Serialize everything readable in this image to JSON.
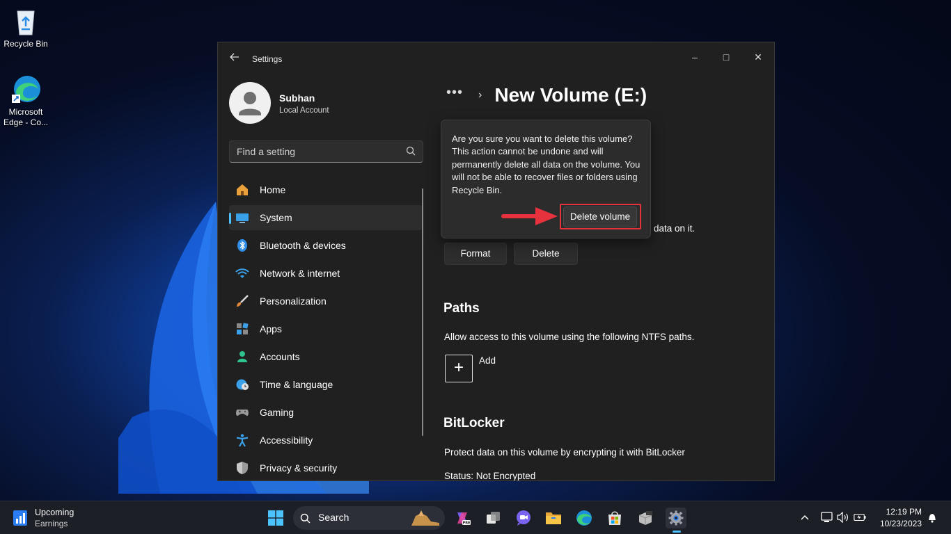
{
  "desktop": {
    "icons": [
      {
        "label": "Recycle Bin"
      },
      {
        "label": "Microsoft Edge - Co..."
      }
    ]
  },
  "window": {
    "title": "Settings",
    "controls": {
      "minimize": "–",
      "maximize": "□",
      "close": "✕"
    }
  },
  "profile": {
    "name": "Subhan",
    "account_type": "Local Account"
  },
  "search": {
    "placeholder": "Find a setting"
  },
  "nav": {
    "items": [
      {
        "label": "Home",
        "icon": "home-icon"
      },
      {
        "label": "System",
        "icon": "monitor-icon",
        "selected": true
      },
      {
        "label": "Bluetooth & devices",
        "icon": "bluetooth-icon"
      },
      {
        "label": "Network & internet",
        "icon": "wifi-icon"
      },
      {
        "label": "Personalization",
        "icon": "brush-icon"
      },
      {
        "label": "Apps",
        "icon": "apps-icon"
      },
      {
        "label": "Accounts",
        "icon": "person-icon"
      },
      {
        "label": "Time & language",
        "icon": "globe-clock-icon"
      },
      {
        "label": "Gaming",
        "icon": "gamepad-icon"
      },
      {
        "label": "Accessibility",
        "icon": "accessibility-icon"
      },
      {
        "label": "Privacy & security",
        "icon": "shield-icon"
      }
    ]
  },
  "breadcrumb": {
    "more": "•••",
    "separator": "›",
    "title": "New Volume (E:)"
  },
  "confirm": {
    "message": "Are you sure you want to delete this volume? This action cannot be undone and will permanently delete all data on the volume. You will not be able to recover files or folders using Recycle Bin.",
    "button_label": "Delete volume",
    "highlight_color": "#e5323c"
  },
  "content": {
    "trailing_text": "data on it.",
    "format_label": "Format",
    "delete_label": "Delete",
    "paths": {
      "heading": "Paths",
      "description": "Allow access to this volume using the following NTFS paths.",
      "add_label": "Add"
    },
    "bitlocker": {
      "heading": "BitLocker",
      "description": "Protect data on this volume by encrypting it with BitLocker",
      "status": "Status: Not Encrypted"
    }
  },
  "taskbar": {
    "news": {
      "title": "Upcoming",
      "subtitle": "Earnings"
    },
    "search_label": "Search",
    "accent": "#4cc2ff",
    "clock": {
      "time": "12:19 PM",
      "date": "10/23/2023"
    }
  }
}
